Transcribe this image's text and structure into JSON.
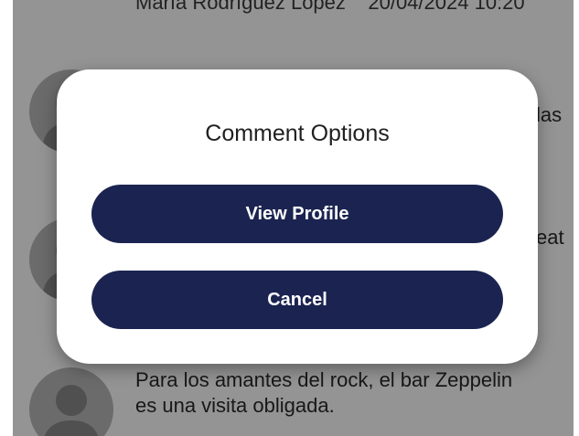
{
  "comments": [
    {
      "author": "María Rodríguez López",
      "timestamp": "20/04/2024 10:20",
      "text_line1": "",
      "text_line2": ""
    },
    {
      "author": "",
      "timestamp": "",
      "text_line1": "las",
      "text_line2": ""
    },
    {
      "author": "",
      "timestamp": "",
      "text_line1": "eat",
      "text_line2": ""
    },
    {
      "author": "",
      "timestamp": "",
      "text_line1": "Para los amantes del rock, el bar Zeppelin",
      "text_line2": "es una visita obligada."
    }
  ],
  "dialog": {
    "title": "Comment Options",
    "view_profile_label": "View Profile",
    "cancel_label": "Cancel"
  },
  "colors": {
    "button_bg": "#1b2450",
    "button_text": "#ffffff",
    "scrim": "rgba(0,0,0,0.42)",
    "avatar_bg": "#b9b9b9",
    "avatar_silhouette": "#8a8a8a"
  },
  "icons": {
    "avatar": "person-silhouette-icon"
  }
}
